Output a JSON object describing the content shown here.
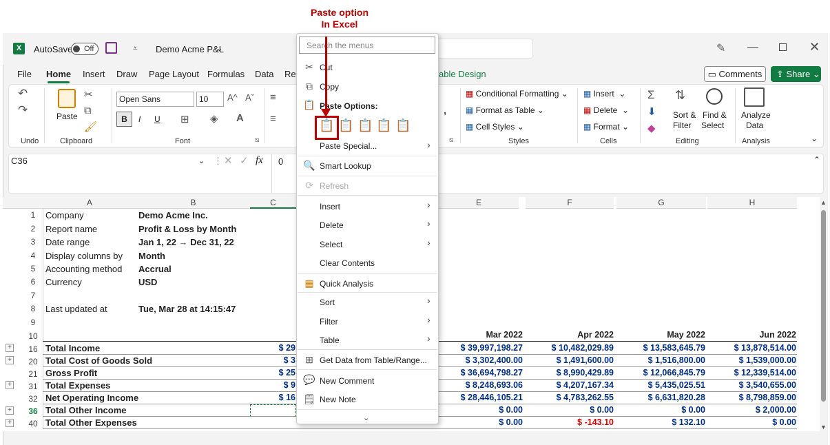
{
  "annotation": {
    "line1": "Paste option",
    "line2": "In Excel"
  },
  "titlebar": {
    "autosave_label": "AutoSave",
    "toggle_state": "Off",
    "document_title": "Demo Acme P&L"
  },
  "tabs": [
    "File",
    "Home",
    "Insert",
    "Draw",
    "Page Layout",
    "Formulas",
    "Data",
    "Rev",
    "able Design"
  ],
  "buttons": {
    "comments": "Comments",
    "share": "Share"
  },
  "ribbon": {
    "undo_label": "Undo",
    "paste_label": "Paste",
    "clipboard_label": "Clipboard",
    "font_name": "Open Sans",
    "font_size": "10",
    "bold": "B",
    "italic": "I",
    "underline": "U",
    "font_label": "Font",
    "conditional_formatting": "Conditional Formatting",
    "format_as_table": "Format as Table",
    "cell_styles": "Cell Styles",
    "styles_label": "Styles",
    "insert": "Insert",
    "delete": "Delete",
    "format": "Format",
    "cells_label": "Cells",
    "sort_filter": "Sort &",
    "sort_filter2": "Filter",
    "find_select": "Find &",
    "find_select2": "Select",
    "editing_label": "Editing",
    "analyze_data": "Analyze",
    "analyze_data2": "Data",
    "analysis_label": "Analysis"
  },
  "formula_bar": {
    "name_box": "C36",
    "fx": "fx",
    "value": "0"
  },
  "columns": [
    "A",
    "B",
    "C",
    "E",
    "F",
    "G",
    "H"
  ],
  "outline_levels": [
    "1",
    "2"
  ],
  "rows": [
    {
      "num": "1",
      "a": "Company",
      "b": "Demo Acme Inc."
    },
    {
      "num": "2",
      "a": "Report name",
      "b": "Profit & Loss by Month"
    },
    {
      "num": "3",
      "a": "Date range",
      "b": "Jan 1, 22 → Dec 31, 22"
    },
    {
      "num": "4",
      "a": "Display columns by",
      "b": "Month"
    },
    {
      "num": "5",
      "a": "Accounting method",
      "b": "Accrual"
    },
    {
      "num": "6",
      "a": "Currency",
      "b": "USD"
    },
    {
      "num": "7",
      "a": "",
      "b": ""
    },
    {
      "num": "8",
      "a": "Last updated at",
      "b": "Tue, Mar 28 at 14:15:47"
    },
    {
      "num": "9",
      "a": "",
      "b": ""
    }
  ],
  "month_headers": {
    "row": "10",
    "e": "Mar 2022",
    "f": "Apr 2022",
    "g": "May 2022",
    "h": "Jun 2022"
  },
  "data_rows": [
    {
      "num": "16",
      "label": "Total Income",
      "c": "$ 29",
      "e": "$ 39,997,198.27",
      "f": "$ 10,482,029.89",
      "g": "$ 13,583,645.79",
      "h": "$ 13,878,514.00"
    },
    {
      "num": "20",
      "label": "Total Cost of Goods Sold",
      "c": "$ 3",
      "e": "$ 3,302,400.00",
      "f": "$ 1,491,600.00",
      "g": "$ 1,516,800.00",
      "h": "$ 1,539,000.00"
    },
    {
      "num": "21",
      "label": "Gross Profit",
      "c": "$ 25",
      "e": "$ 36,694,798.27",
      "f": "$ 8,990,429.89",
      "g": "$ 12,066,845.79",
      "h": "$ 12,339,514.00"
    },
    {
      "num": "31",
      "label": "Total Expenses",
      "c": "$ 9",
      "e": "$ 8,248,693.06",
      "f": "$ 4,207,167.34",
      "g": "$ 5,435,025.51",
      "h": "$ 3,540,655.00"
    },
    {
      "num": "32",
      "label": "Net Operating Income",
      "c": "$ 16",
      "e": "$ 28,446,105.21",
      "f": "$ 4,783,262.55",
      "g": "$ 6,631,820.28",
      "h": "$ 8,798,859.00"
    },
    {
      "num": "36",
      "label": "Total Other Income",
      "c": "",
      "e": "$ 0.00",
      "f": "$ 0.00",
      "g": "$ 0.00",
      "h": "$ 2,000.00"
    },
    {
      "num": "40",
      "label": "Total Other Expenses",
      "c": "",
      "e": "$ 0.00",
      "f": "$ -143.10",
      "g": "$ 132.10",
      "h": "$ 0.00"
    }
  ],
  "plus_symbol": "+",
  "context_menu": {
    "search_placeholder": "Search the menus",
    "cut": "Cut",
    "copy": "Copy",
    "paste_options": "Paste Options:",
    "paste_special": "Paste Special...",
    "smart_lookup": "Smart Lookup",
    "refresh": "Refresh",
    "insert": "Insert",
    "delete": "Delete",
    "select": "Select",
    "clear_contents": "Clear Contents",
    "quick_analysis": "Quick Analysis",
    "sort": "Sort",
    "filter": "Filter",
    "table": "Table",
    "get_data": "Get Data from Table/Range...",
    "new_comment": "New Comment",
    "new_note": "New Note"
  },
  "colors": {
    "excel_green": "#107c41",
    "annotation_red": "#c00000",
    "number_blue": "#002e8a",
    "negative_red": "#e00000"
  }
}
